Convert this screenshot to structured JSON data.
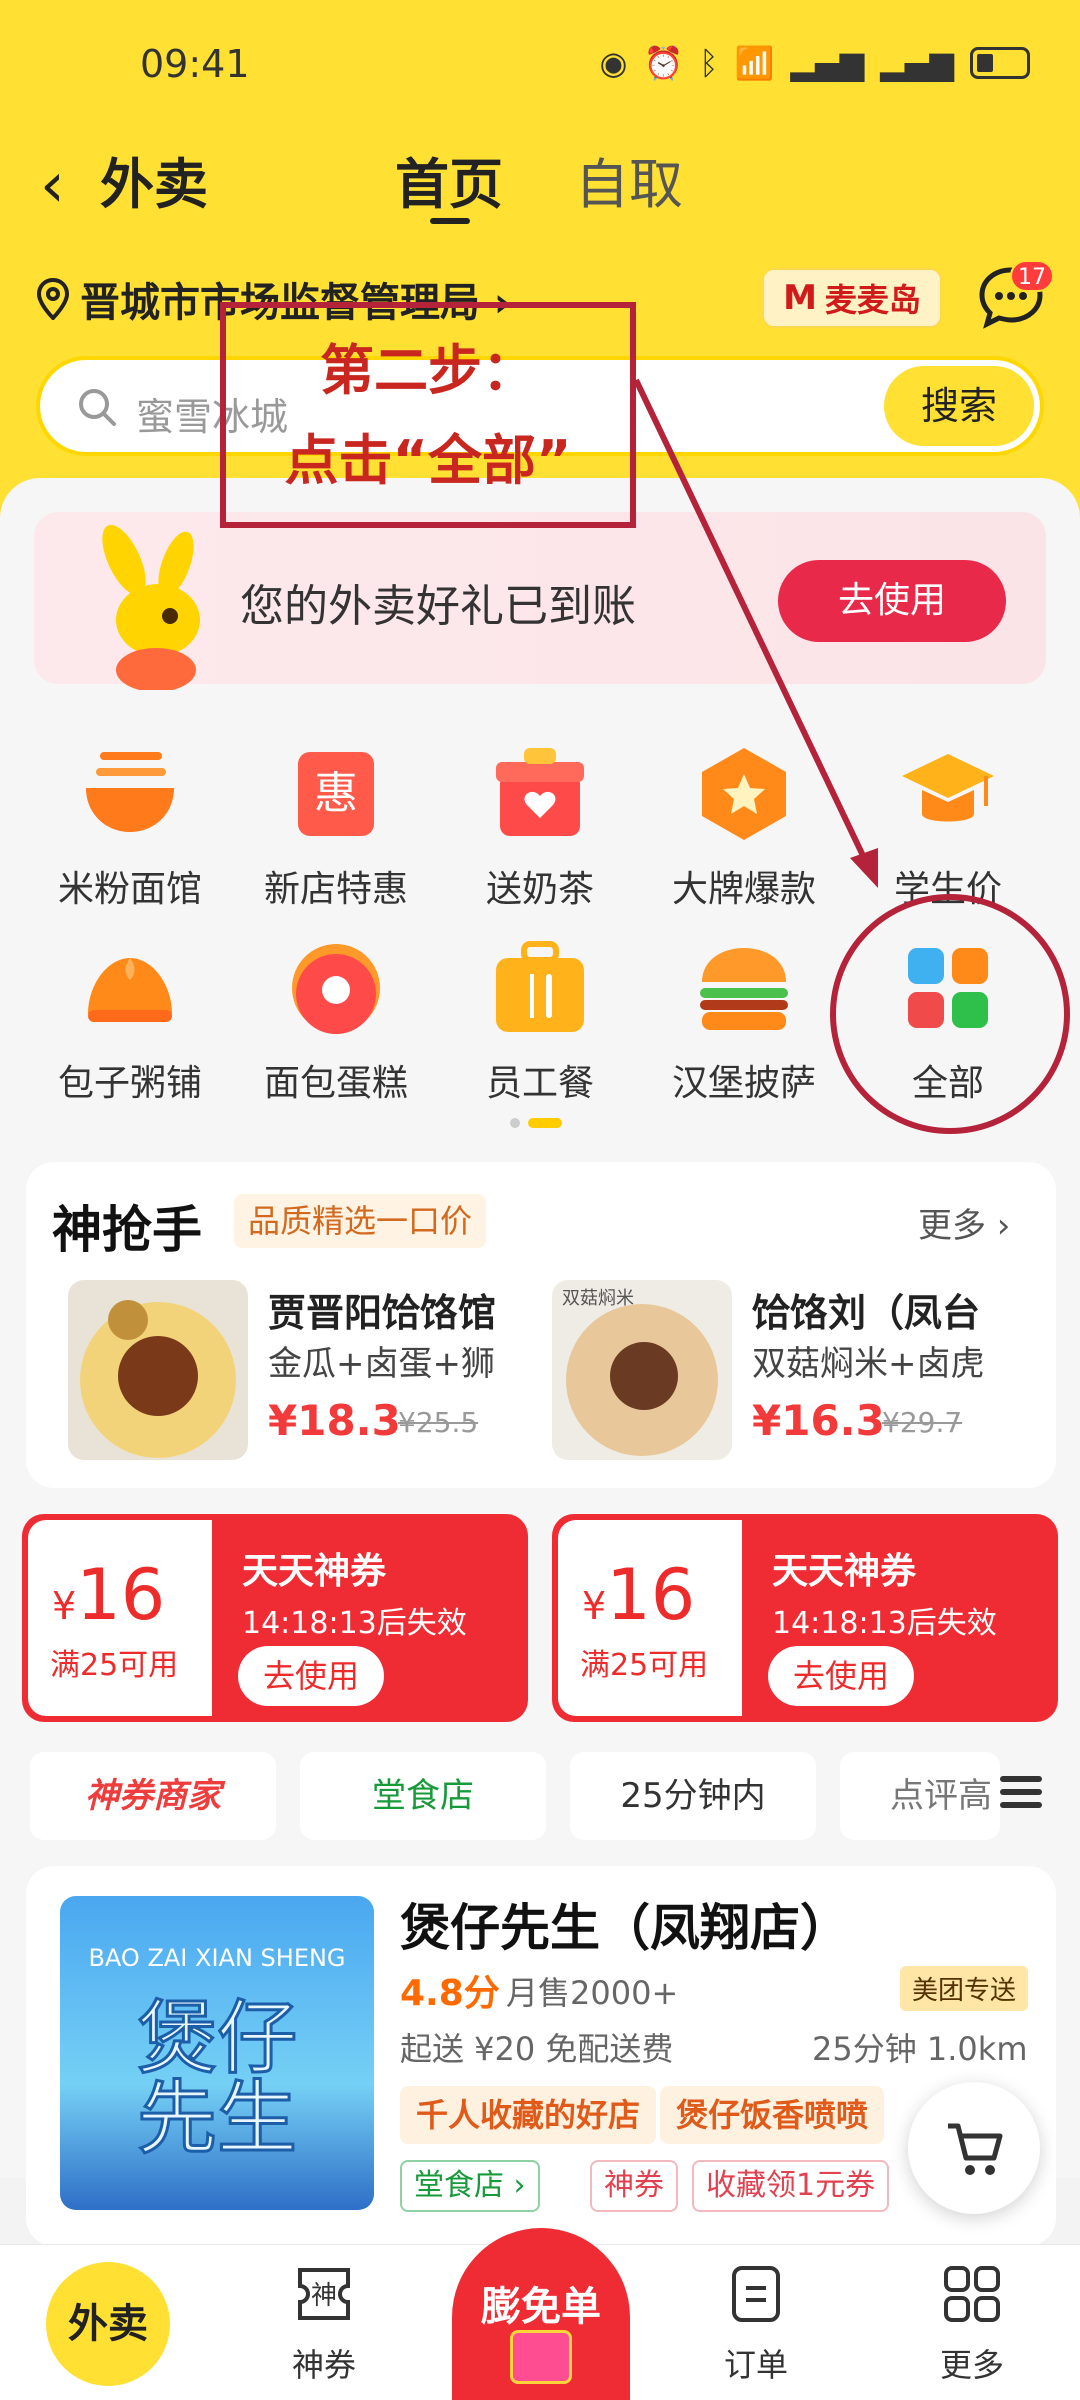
{
  "status": {
    "time": "09:41"
  },
  "header": {
    "back_label": "外卖",
    "tab_home": "首页",
    "tab_pickup": "自取"
  },
  "location": {
    "text": "晋城市市场监督管理局 ›"
  },
  "brand_badge": {
    "label": "麦麦岛",
    "logo": "M"
  },
  "messages": {
    "count": "17"
  },
  "search": {
    "placeholder": "蜜雪冰城",
    "button": "搜索"
  },
  "promo": {
    "text": "您的外卖好礼已到账",
    "button": "去使用"
  },
  "categories": [
    {
      "label": "米粉面馆",
      "icon": "noodle-bowl-icon"
    },
    {
      "label": "新店特惠",
      "icon": "hui-discount-icon"
    },
    {
      "label": "送奶茶",
      "icon": "gift-box-icon"
    },
    {
      "label": "大牌爆款",
      "icon": "star-badge-icon"
    },
    {
      "label": "学生价",
      "icon": "graduation-cap-icon"
    },
    {
      "label": "包子粥铺",
      "icon": "bun-icon"
    },
    {
      "label": "面包蛋糕",
      "icon": "donut-icon"
    },
    {
      "label": "员工餐",
      "icon": "lunchbox-icon"
    },
    {
      "label": "汉堡披萨",
      "icon": "burger-icon"
    },
    {
      "label": "全部",
      "icon": "all-grid-icon"
    }
  ],
  "snap": {
    "title": "神抢手",
    "tag": "品质精选一口价",
    "more": "更多 ›",
    "items": [
      {
        "name": "贾晋阳饸饹馆",
        "desc": "金瓜+卤蛋+狮",
        "price": "¥18.3",
        "old_price": "¥25.5"
      },
      {
        "name": "饸饹刘（凤台",
        "desc": "双菇焖米+卤虎",
        "price": "¥16.3",
        "old_price": "¥29.7"
      }
    ]
  },
  "coupons": [
    {
      "currency": "¥",
      "amount": "16",
      "condition": "满25可用",
      "title": "天天神券",
      "expire": "14:18:13后失效",
      "button": "去使用"
    },
    {
      "currency": "¥",
      "amount": "16",
      "condition": "满25可用",
      "title": "天天神券",
      "expire": "14:18:13后失效",
      "button": "去使用"
    }
  ],
  "filters": [
    "神券商家",
    "堂食店",
    "25分钟内",
    "点评高"
  ],
  "store": {
    "name": "煲仔先生（凤翔店）",
    "rating": "4.8分",
    "sales": "月售2000+",
    "delivery_tag": "美团专送",
    "fee": "起送 ¥20  免配送费",
    "distance": "25分钟  1.0km",
    "highlights": [
      "千人收藏的好店",
      "煲仔饭香喷喷"
    ],
    "chips": [
      "堂食店 ›",
      "神券",
      "收藏领1元券"
    ],
    "image_text": "BAO ZAI XIAN SHENG"
  },
  "bottom_nav": {
    "waimai": "外卖",
    "coupon": "神券",
    "center": "膨免单",
    "orders": "订单",
    "more": "更多"
  },
  "annotation": {
    "line1": "第二步：",
    "line2": "点击“全部”"
  }
}
